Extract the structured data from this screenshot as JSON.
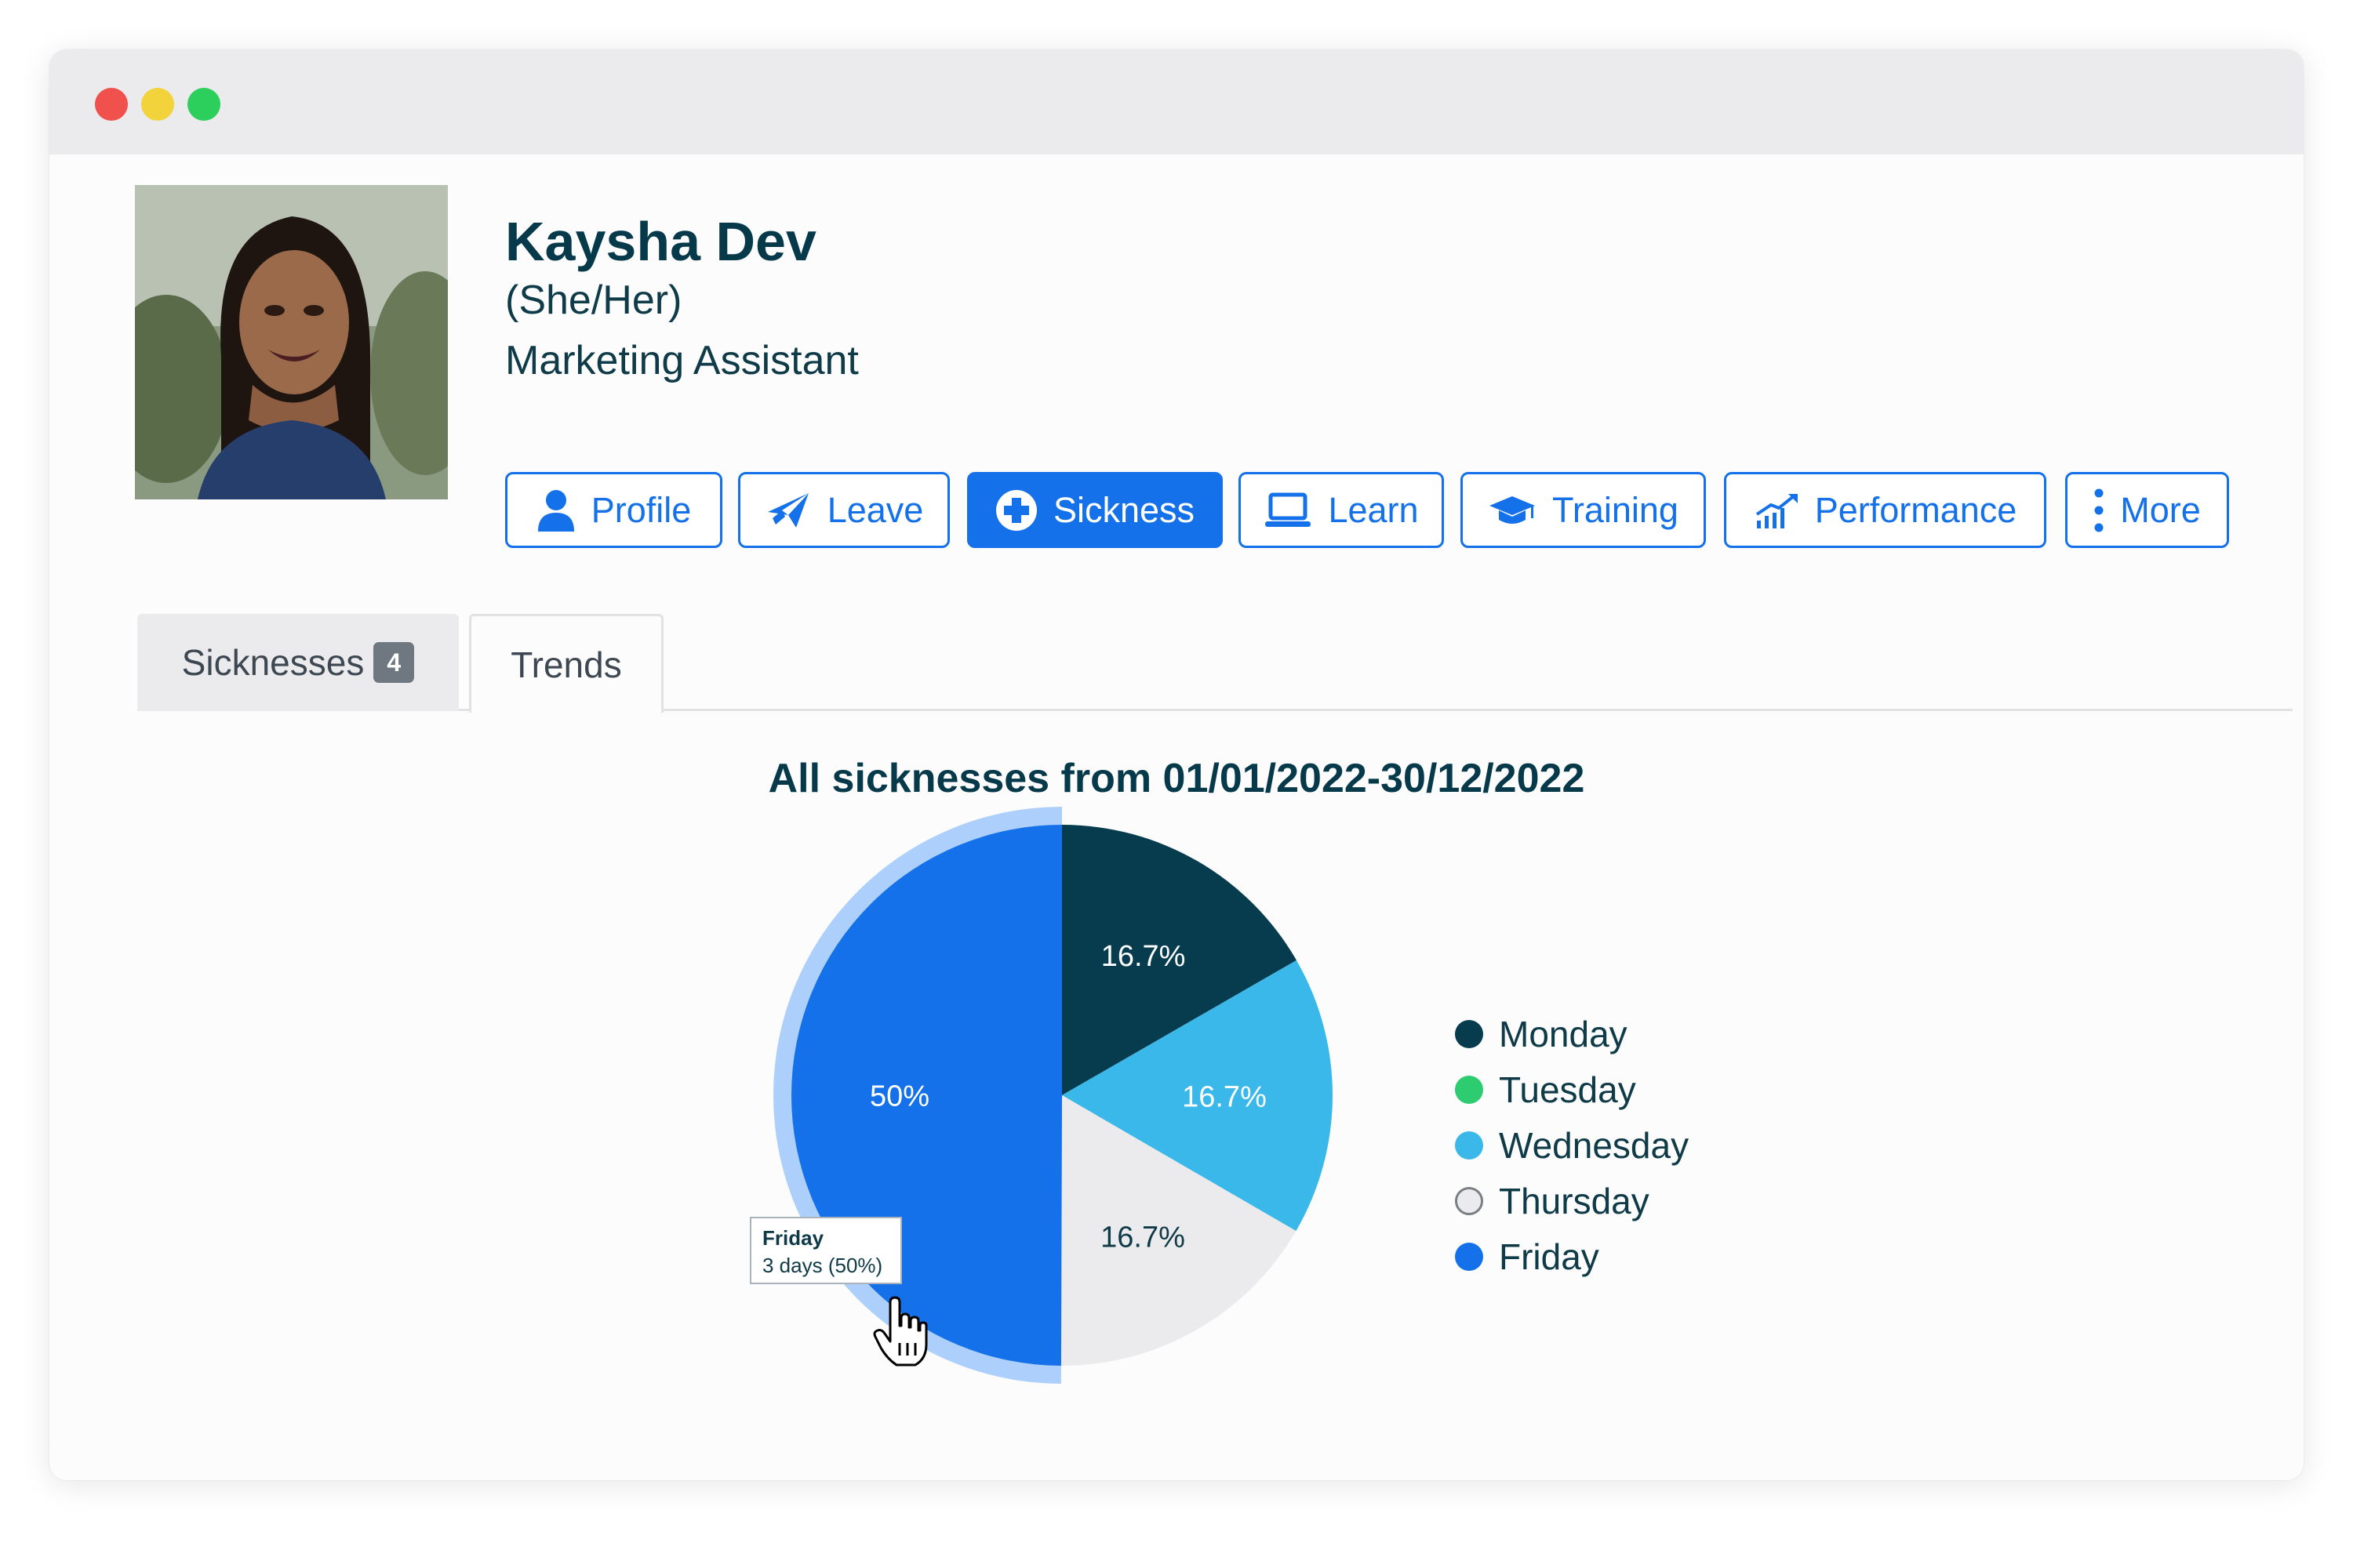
{
  "window": {
    "controls": [
      "close",
      "minimize",
      "maximize"
    ],
    "colors": {
      "close": "#f1514c",
      "minimize": "#f3d33b",
      "maximize": "#2ccf5b"
    }
  },
  "profile": {
    "name": "Kaysha Dev",
    "pronouns": "(She/Her)",
    "job_title": "Marketing Assistant"
  },
  "nav": {
    "buttons": [
      {
        "label": "Profile",
        "icon": "user-icon"
      },
      {
        "label": "Leave",
        "icon": "plane-icon"
      },
      {
        "label": "Sickness",
        "icon": "medical-plus-icon",
        "active": true
      },
      {
        "label": "Learn",
        "icon": "laptop-icon"
      },
      {
        "label": "Training",
        "icon": "graduation-cap-icon"
      },
      {
        "label": "Performance",
        "icon": "growth-chart-icon"
      },
      {
        "label": "More",
        "icon": "vertical-dots-icon"
      }
    ],
    "accent": "#1471ea"
  },
  "tabs": [
    {
      "label": "Sicknesses",
      "badge": "4"
    },
    {
      "label": "Trends",
      "active": true
    }
  ],
  "chart_data": {
    "type": "pie",
    "title": "All sicknesses from 01/01/2022-30/12/2022",
    "legend_position": "right",
    "slices": [
      {
        "label": "Monday",
        "value": 16.7,
        "display": "16.7%",
        "color": "#063c4e"
      },
      {
        "label": "Tuesday",
        "value": 0,
        "display": "",
        "color": "#2ecc71"
      },
      {
        "label": "Wednesday",
        "value": 16.7,
        "display": "16.7%",
        "color": "#3ab8ea"
      },
      {
        "label": "Thursday",
        "value": 16.7,
        "display": "16.7%",
        "color": "#ebebed"
      },
      {
        "label": "Friday",
        "value": 50,
        "display": "50%",
        "color": "#1471ea",
        "highlighted": true
      }
    ],
    "tooltip": {
      "title": "Friday",
      "body": "3 days (50%)"
    }
  }
}
